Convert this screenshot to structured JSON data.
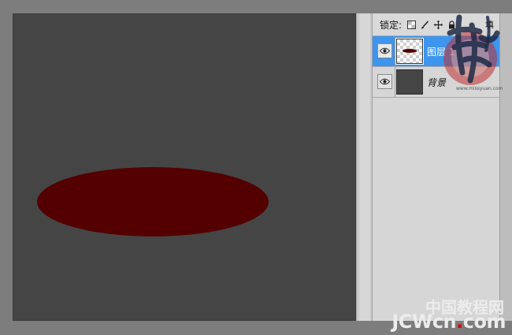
{
  "canvas": {
    "background_color": "#454545",
    "shape": {
      "kind": "ellipse",
      "color": "#540000"
    }
  },
  "layers_panel": {
    "lock_label": "锁定:",
    "lock_icons": [
      "lock-transparent-pixels-icon",
      "lock-image-pixels-icon",
      "lock-position-icon",
      "lock-all-icon"
    ],
    "trailing_glyph": "填",
    "layers": [
      {
        "name": "图层 1",
        "selected": true,
        "visible": true,
        "icon": "eye-icon"
      },
      {
        "name": "背景",
        "selected": false,
        "visible": true,
        "icon": "eye-icon"
      }
    ],
    "selection_color": "#3d95ee"
  },
  "watermark": {
    "logo_url_text": "www.missyuan.com",
    "site_name_cn": "中国教程网",
    "site_name_en_parts": [
      "JCWcn",
      ".",
      "com"
    ]
  }
}
